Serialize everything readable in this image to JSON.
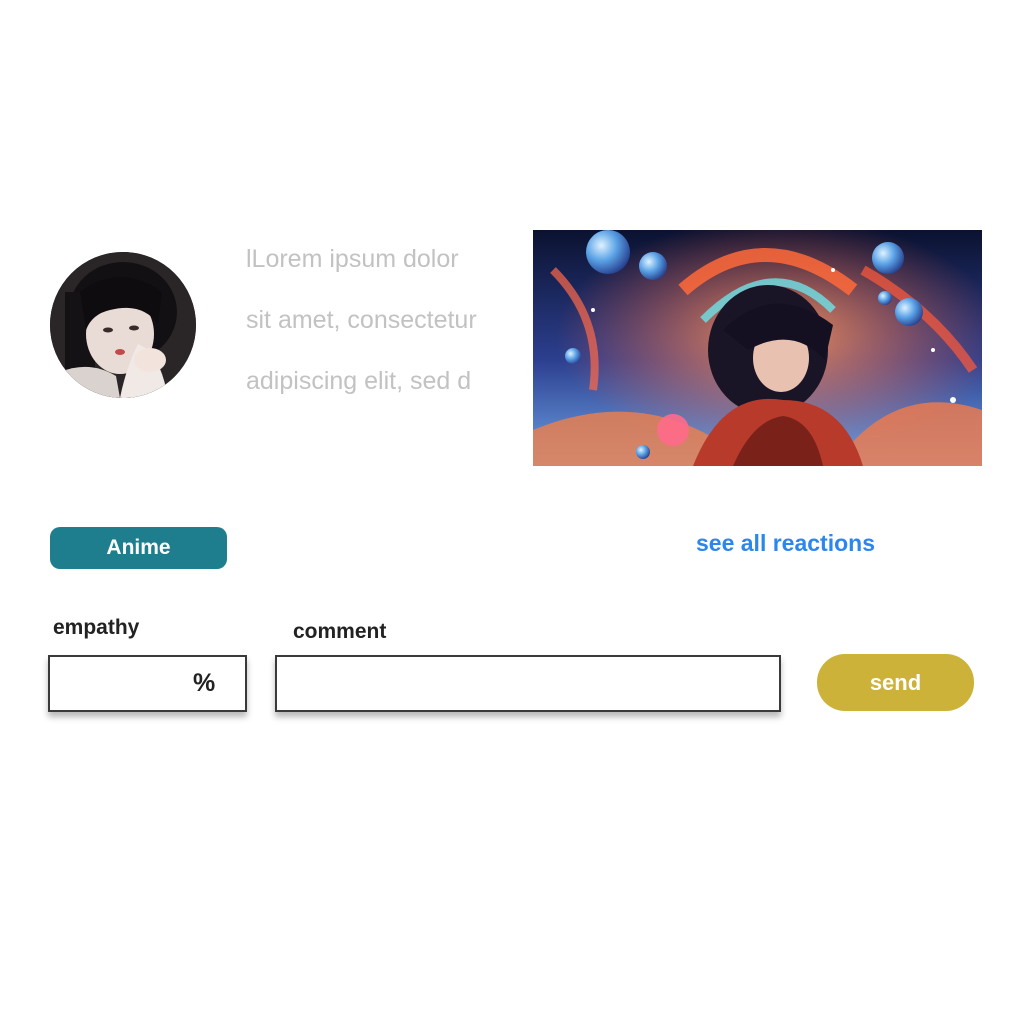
{
  "post": {
    "avatar_icon": "user-avatar-photo",
    "text_lines": [
      "lLorem ipsum dolor",
      "sit amet, consectetur",
      "adipiscing elit, sed d"
    ],
    "image_icon": "anime-illustration-image",
    "tag_label": "Anime",
    "reactions_link": "see all reactions"
  },
  "form": {
    "empathy_label": "empathy",
    "empathy_value": "",
    "empathy_unit": "%",
    "comment_label": "comment",
    "comment_value": "",
    "send_label": "send"
  },
  "colors": {
    "tag_background": "#1e7e8e",
    "link": "#2b86ee",
    "send_background": "#cdb23a",
    "body_text_muted": "#c2c2c2"
  }
}
